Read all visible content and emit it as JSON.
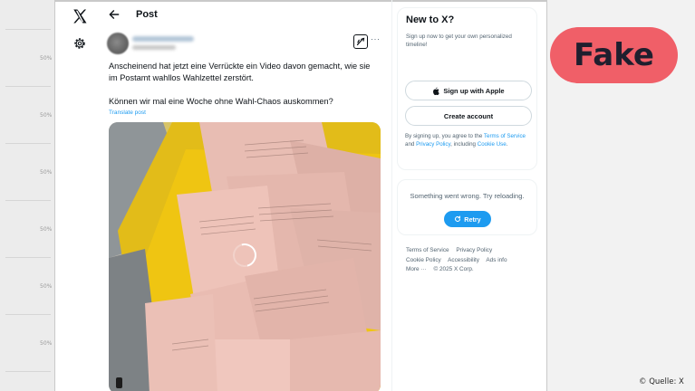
{
  "ruler": {
    "labels": [
      "50%",
      "50%",
      "50%",
      "50%",
      "50%",
      "50%"
    ]
  },
  "nav": {
    "logo_icon": "x-logo-icon",
    "settings_icon": "gear-icon"
  },
  "header": {
    "back_icon": "arrow-left-icon",
    "title": "Post"
  },
  "tweet": {
    "grok_icon": "grok-icon",
    "more_icon": "more-horizontal-icon",
    "more_glyph": "···",
    "text_1": "Anscheinend hat jetzt eine Verrückte ein Video davon gemacht, wie sie im Postamt wahllos Wahlzettel zerstört.",
    "text_2": "Können wir mal eine Woche ohne Wahl-Chaos auskommen?",
    "translate": "Translate post",
    "media": {
      "type": "video",
      "loading": true
    }
  },
  "sidebar": {
    "new_title": "New to X?",
    "new_sub": "Sign up now to get your own personalized timeline!",
    "apple_btn": "Sign up with Apple",
    "create_btn": "Create account",
    "terms": {
      "prefix": "By signing up, you agree to the",
      "tos": "Terms of Service",
      "and": "and",
      "privacy": "Privacy Policy",
      "including": ", including",
      "cookie": "Cookie Use",
      "end": "."
    },
    "error_text": "Something went wrong. Try reloading.",
    "retry_btn": "Retry",
    "footer": {
      "tos": "Terms of Service",
      "privacy": "Privacy Policy",
      "cookie": "Cookie Policy",
      "accessibility": "Accessibility",
      "ads": "Ads info",
      "more": "More ···",
      "copyright": "© 2025 X Corp."
    }
  },
  "overlay": {
    "badge": "Fake",
    "badge_color": "#f05f68",
    "source": "© Quelle: X"
  },
  "colors": {
    "accent": "#1d9bf0",
    "text": "#0f1419",
    "muted": "#536471"
  }
}
